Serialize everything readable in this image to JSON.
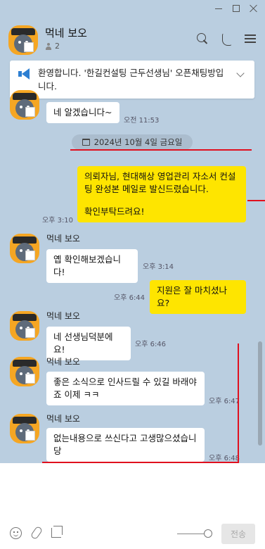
{
  "window": {
    "controls": [
      "minimize",
      "maximize",
      "close"
    ]
  },
  "header": {
    "title": "먹네 보오",
    "member_count": "2",
    "icons": [
      "search-icon",
      "phone-icon",
      "menu-icon"
    ]
  },
  "notice": {
    "text": "환영합니다. '한길컨설팅 근두선생님' 오픈채팅방입니다."
  },
  "date_divider": "2024년 10월 4일 금요일",
  "messages": [
    {
      "from": "other",
      "text": "네 알겠습니다~",
      "time": "오전 11:53"
    },
    {
      "from": "me",
      "text": "의뢰자님, 현대해상 영업관리 자소서 컨설팅 완성본 메일로 발신드렸습니다.",
      "text2": "확인부탁드려요!",
      "time": "오후 3:10"
    },
    {
      "from": "other",
      "sender": "먹네 보오",
      "text": "옙 확인해보겠습니다!",
      "time": "오후 3:14"
    },
    {
      "from": "me",
      "text": "지원은 잘 마치셨나요?",
      "time": "오후 6:44"
    },
    {
      "from": "other",
      "sender": "먹네 보오",
      "text": "네 선생님덕분에요!",
      "time": "오후 6:46"
    },
    {
      "from": "other",
      "sender": "먹네 보오",
      "text": "좋은 소식으로 인사드릴 수 있길 바래야죠 이제 ㅋㅋ",
      "time": "오후 6:47"
    },
    {
      "from": "other",
      "sender": "먹네 보오",
      "text": "없는내용으로 쓰신다고 고생많으셨습니당",
      "time": "오후 6:48"
    }
  ],
  "composer": {
    "icons": [
      "emoji-icon",
      "attach-icon",
      "crop-icon"
    ],
    "send_label": "전송"
  },
  "colors": {
    "background": "#bacee0",
    "my_bubble": "#fee500",
    "other_bubble": "#ffffff",
    "annotation": "#e0101e"
  }
}
